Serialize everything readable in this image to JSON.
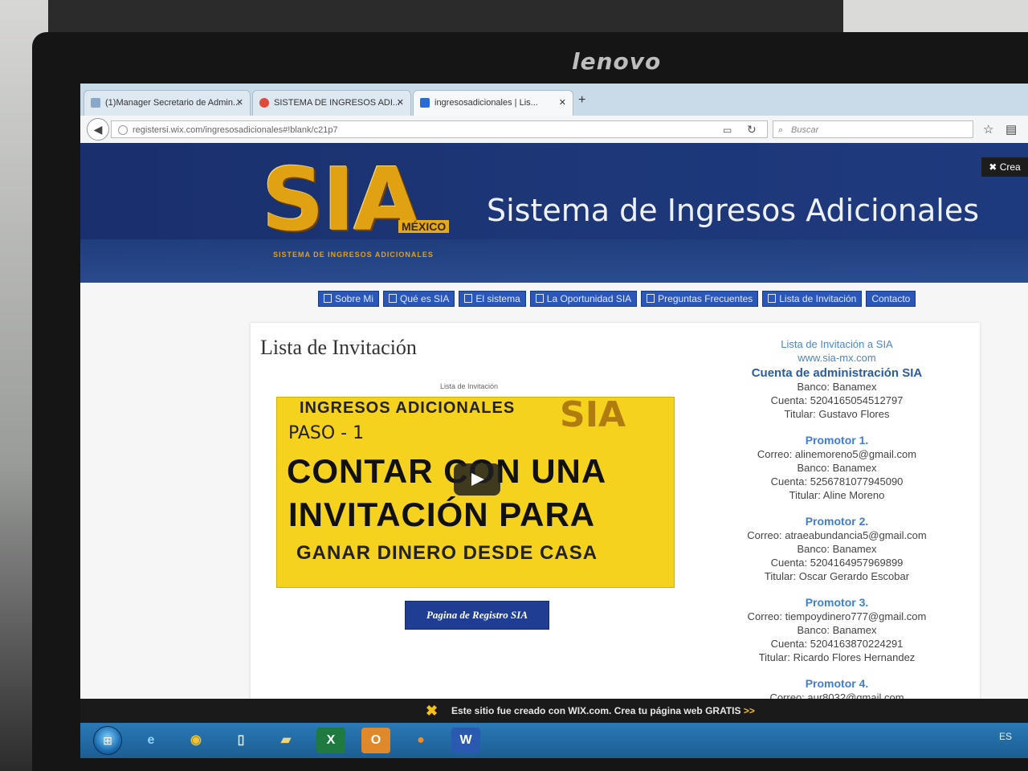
{
  "monitor": {
    "brand": "lenovo"
  },
  "browser": {
    "tabs": [
      {
        "label": "(1)Manager Secretario de Admin...",
        "active": false
      },
      {
        "label": "SISTEMA DE INGRESOS ADI...",
        "active": false
      },
      {
        "label": "ingresosadicionales | Lis...",
        "active": true
      }
    ],
    "new_tab": "+",
    "url": "registersi.wix.com/ingresosadicionales#!blank/c21p7",
    "search_placeholder": "Buscar",
    "icons": [
      "back-arrow-icon",
      "info-icon",
      "reader-icon",
      "reload-icon",
      "search-icon",
      "star-icon",
      "clipboard-icon"
    ]
  },
  "site": {
    "logo": {
      "text": "SIA",
      "sub": "MÉXICO",
      "tagline": "SISTEMA DE INGRESOS ADICIONALES"
    },
    "banner_title": "Sistema de Ingresos Adicionales",
    "wix_crea": "Crea",
    "menu": [
      "Sobre Mi",
      "Qué es SIA",
      "El sistema",
      "La Oportunidad SIA",
      "Preguntas Frecuentes",
      "Lista de Invitación",
      "Contacto"
    ],
    "page_title": "Lista de Invitación",
    "video": {
      "caption": "Lista de Invitación",
      "line1": "INGRESOS ADICIONALES",
      "brand": "SIA",
      "step": "PASO - 1",
      "big1": "CONTAR CON UNA",
      "big2": "INVITACIÓN PARA",
      "line4": "GANAR DINERO DESDE CASA"
    },
    "register_button": "Pagina de Registro SIA",
    "sidebar": {
      "heading": "Lista de Invitación a SIA",
      "website": "www.sia-mx.com",
      "admin": {
        "title": "Cuenta de administración SIA",
        "bank": "Banco: Banamex",
        "account": "Cuenta: 5204165054512797",
        "holder": "Titular: Gustavo Flores"
      },
      "promoters": [
        {
          "title": "Promotor 1.",
          "email": "Correo: alinemoreno5@gmail.com",
          "bank": "Banco: Banamex",
          "account": "Cuenta: 5256781077945090",
          "holder": "Titular: Aline Moreno"
        },
        {
          "title": "Promotor 2.",
          "email": "Correo: atraeabundancia5@gmail.com",
          "bank": "Banco: Banamex",
          "account": "Cuenta: 5204164957969899",
          "holder": "Titular: Oscar Gerardo Escobar"
        },
        {
          "title": "Promotor 3.",
          "email": "Correo: tiempoydinero777@gmail.com",
          "bank": "Banco: Banamex",
          "account": "Cuenta: 5204163870224291",
          "holder": "Titular: Ricardo Flores Hernandez"
        },
        {
          "title": "Promotor 4.",
          "email": "Correo: aur8032@gmail.com"
        }
      ]
    },
    "wix_footer": {
      "text": "Este sitio fue creado con WIX.com. Crea tu página web GRATIS",
      "arrows": ">>"
    }
  },
  "taskbar": {
    "start": "start-orb",
    "apps": [
      "internet-explorer-icon",
      "chrome-icon",
      "file-icon",
      "folder-icon",
      "excel-icon",
      "outlook-icon",
      "firefox-icon",
      "word-icon"
    ],
    "tray_text": "ES"
  }
}
